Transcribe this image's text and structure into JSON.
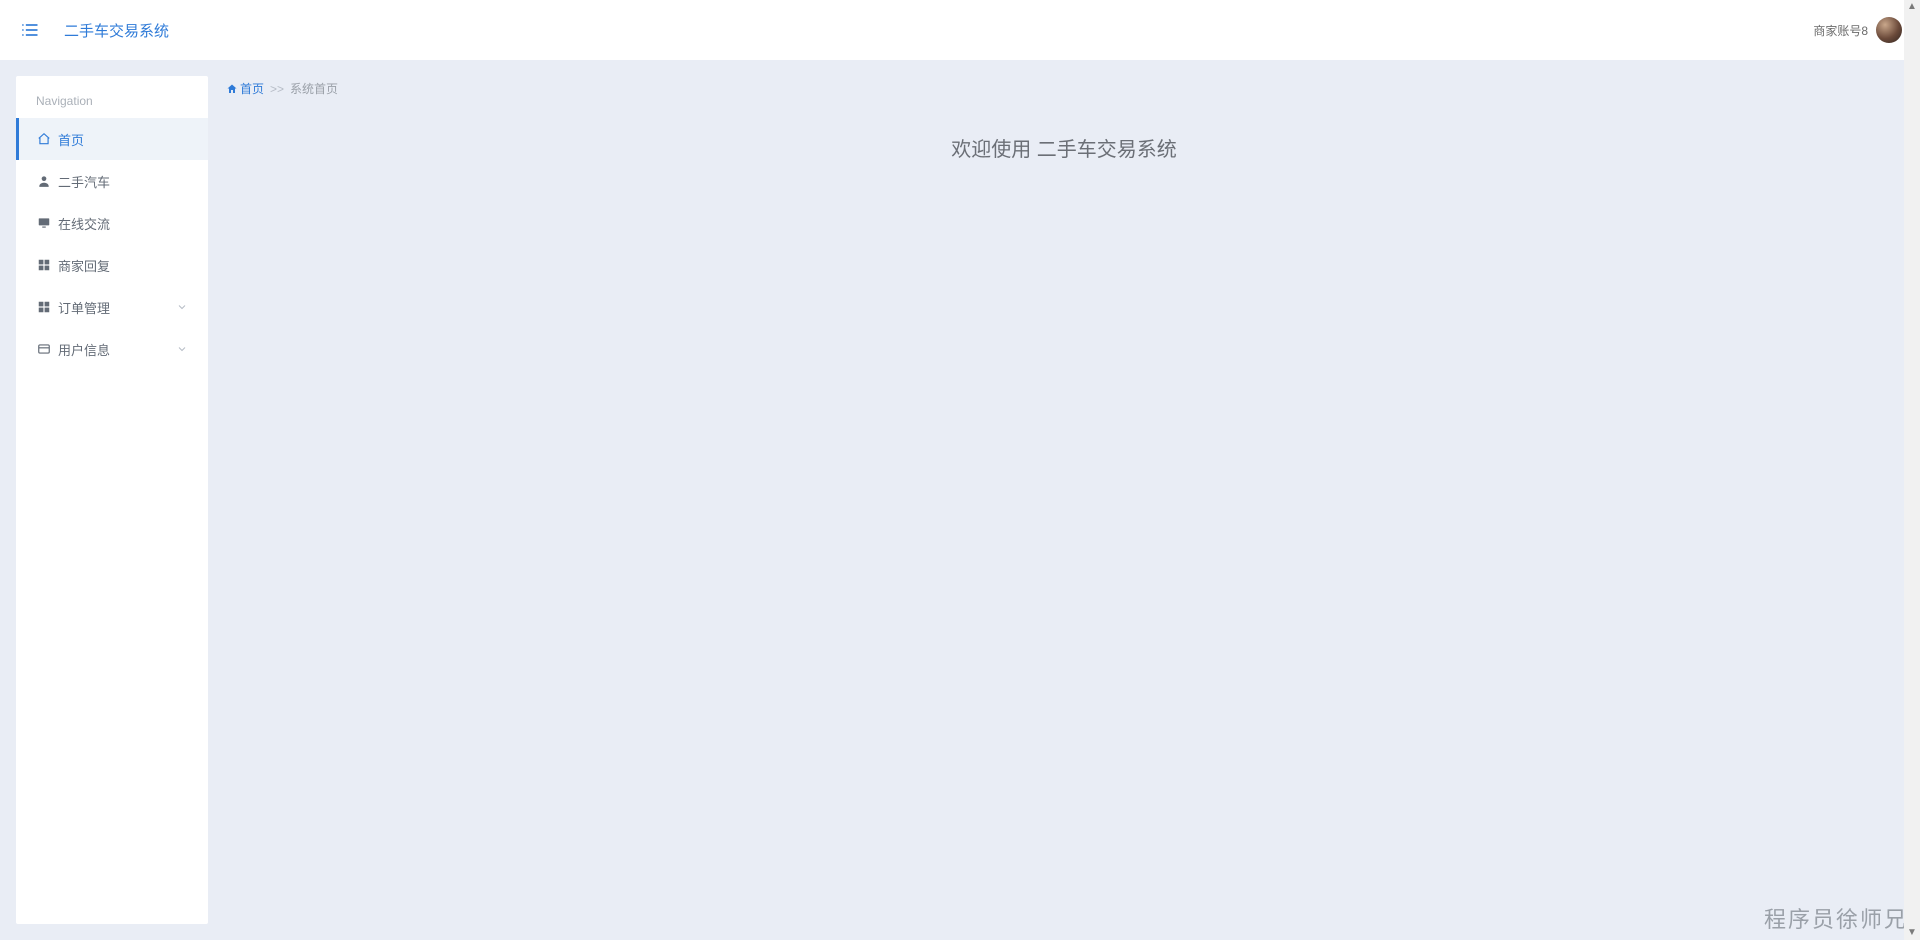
{
  "header": {
    "app_title": "二手车交易系统",
    "user_name": "商家账号8"
  },
  "sidebar": {
    "heading": "Navigation",
    "items": [
      {
        "label": "首页"
      },
      {
        "label": "二手汽车"
      },
      {
        "label": "在线交流"
      },
      {
        "label": "商家回复"
      },
      {
        "label": "订单管理"
      },
      {
        "label": "用户信息"
      }
    ]
  },
  "breadcrumb": {
    "home": "首页",
    "separator": ">>",
    "current": "系统首页"
  },
  "main": {
    "welcome": "欢迎使用 二手车交易系统"
  },
  "watermark": "程序员徐师兄"
}
